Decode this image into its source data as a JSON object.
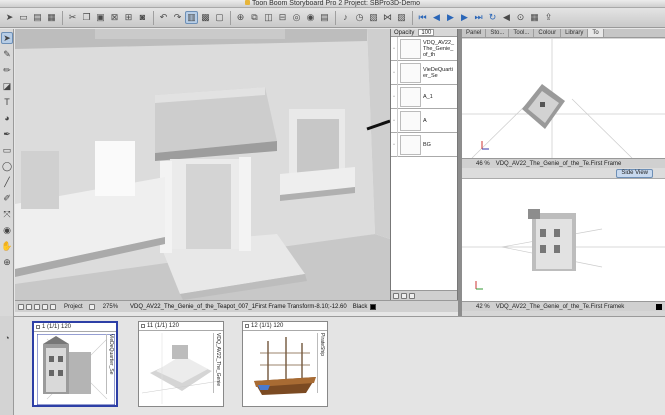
{
  "window": {
    "title": "Toon Boom Storyboard Pro 2 Project: SBPro3D-Demo"
  },
  "layers": {
    "opacity_label": "Opacity",
    "opacity_value": "100",
    "items": [
      {
        "name": "VDQ_AV22_The_Genie_of_th"
      },
      {
        "name": "VieDeQuartier_Se"
      },
      {
        "name": "A_1"
      },
      {
        "name": "A"
      },
      {
        "name": "BG"
      }
    ]
  },
  "stage_footer": {
    "mode": "Project",
    "zoom": "275%",
    "info": "VDQ_AV22_The_Genie_of_the_Teapot_007_1First Frame Transform-8.10;-12.60",
    "color_name": "Black"
  },
  "right_tabs": [
    {
      "label": "Panel"
    },
    {
      "label": "Sto..."
    },
    {
      "label": "Tool..."
    },
    {
      "label": "Colour"
    },
    {
      "label": "Library"
    },
    {
      "label": "To"
    }
  ],
  "top_view": {
    "zoom": "46 %",
    "info": "VDQ_AV22_The_Genie_of_the_Te.First Frame"
  },
  "side_view": {
    "button_label": "Side View",
    "zoom": "42 %",
    "info": "VDQ_AV22_The_Genie_of_the_Te.First Framek"
  },
  "thumbnails": [
    {
      "label": "1 (1/1) 120",
      "side_label": "VieDeQuartier_Se",
      "selected": true
    },
    {
      "label": "11 (1/1) 120",
      "side_label": "VDQ_AV22_The_Genie",
      "selected": false
    },
    {
      "label": "12 (1/1) 120",
      "side_label": "PirateShip",
      "selected": false
    }
  ],
  "colors": {
    "selection_blue": "#2d3fa6",
    "tool_highlight": "#b7cde6",
    "side_view_button": "#c8d9ee"
  }
}
